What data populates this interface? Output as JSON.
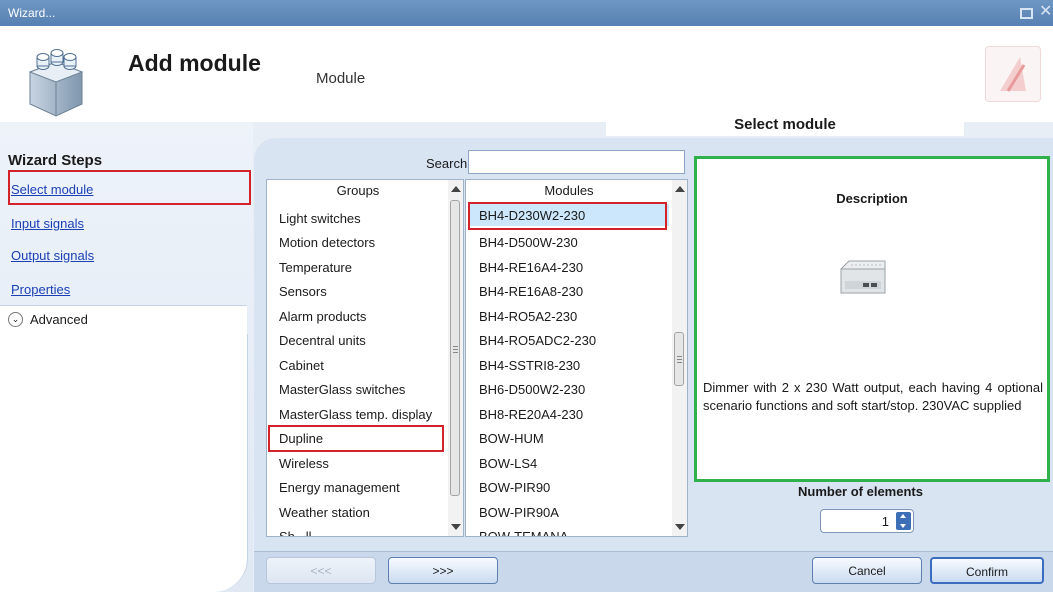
{
  "window": {
    "title": "Wizard..."
  },
  "header": {
    "title": "Add module",
    "subtitle": "Module"
  },
  "sidebar": {
    "heading": "Wizard Steps",
    "steps": [
      "Select module",
      "Input signals",
      "Output signals",
      "Properties"
    ],
    "advanced_label": "Advanced"
  },
  "tab": {
    "label": "Select module"
  },
  "search": {
    "label": "Search",
    "value": ""
  },
  "groups": {
    "header": "Groups",
    "items": [
      "Light switches",
      "Motion detectors",
      "Temperature",
      "Sensors",
      "Alarm products",
      "Decentral units",
      "Cabinet",
      "MasterGlass switches",
      "MasterGlass temp. display",
      "Dupline",
      "Wireless",
      "Energy management",
      "Weather station",
      "Sh...ll..."
    ]
  },
  "modules": {
    "header": "Modules",
    "items": [
      "BH4-D230W2-230",
      "BH4-D500W-230",
      "BH4-RE16A4-230",
      "BH4-RE16A8-230",
      "BH4-RO5A2-230",
      "BH4-RO5ADC2-230",
      "BH4-SSTRI8-230",
      "BH6-D500W2-230",
      "BH8-RE20A4-230",
      "BOW-HUM",
      "BOW-LS4",
      "BOW-PIR90",
      "BOW-PIR90A",
      "BOW-TEMANA"
    ]
  },
  "description": {
    "title": "Description",
    "text": "Dimmer with 2 x 230 Watt output, each having 4 optional scenario functions and soft start/stop. 230VAC supplied"
  },
  "elements": {
    "label": "Number of elements",
    "value": "1"
  },
  "buttons": {
    "back": "<<<",
    "next": ">>>",
    "cancel": "Cancel",
    "confirm": "Confirm"
  },
  "colors": {
    "highlight_red": "#d3222a",
    "description_border": "#2fb14d",
    "link_blue": "#1a3fb5",
    "selected_row": "#cce7fb"
  }
}
